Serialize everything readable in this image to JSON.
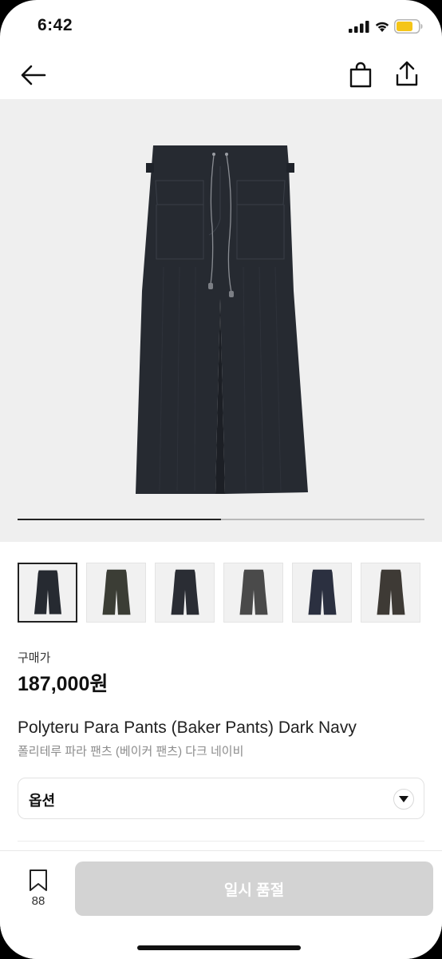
{
  "status_bar": {
    "time": "6:42",
    "battery_color": "#f5c518"
  },
  "nav": {
    "back_icon": "arrow-left-icon",
    "bag_icon": "shopping-bag-icon",
    "share_icon": "share-icon"
  },
  "hero": {
    "image_subject": "pants",
    "color": "#262a31",
    "carousel_progress": 0.5
  },
  "thumbnails": [
    {
      "color": "#262a31",
      "active": true
    },
    {
      "color": "#3b3d35",
      "active": false
    },
    {
      "color": "#2a2d34",
      "active": false
    },
    {
      "color": "#4a4a4a",
      "active": false
    },
    {
      "color": "#2b3040",
      "active": false
    },
    {
      "color": "#3e3a35",
      "active": false
    }
  ],
  "price": {
    "label": "구매가",
    "value": "187,000원"
  },
  "product": {
    "title_en": "Polyteru Para Pants (Baker Pants) Dark Navy",
    "title_ko": "폴리테루 파라 팬츠 (베이커 팬츠) 다크 네이비"
  },
  "option": {
    "label": "옵션",
    "icon": "chevron-down-icon"
  },
  "bottom_bar": {
    "bookmark_count": "88",
    "bookmark_icon": "bookmark-icon",
    "soldout_label": "일시 품절"
  }
}
